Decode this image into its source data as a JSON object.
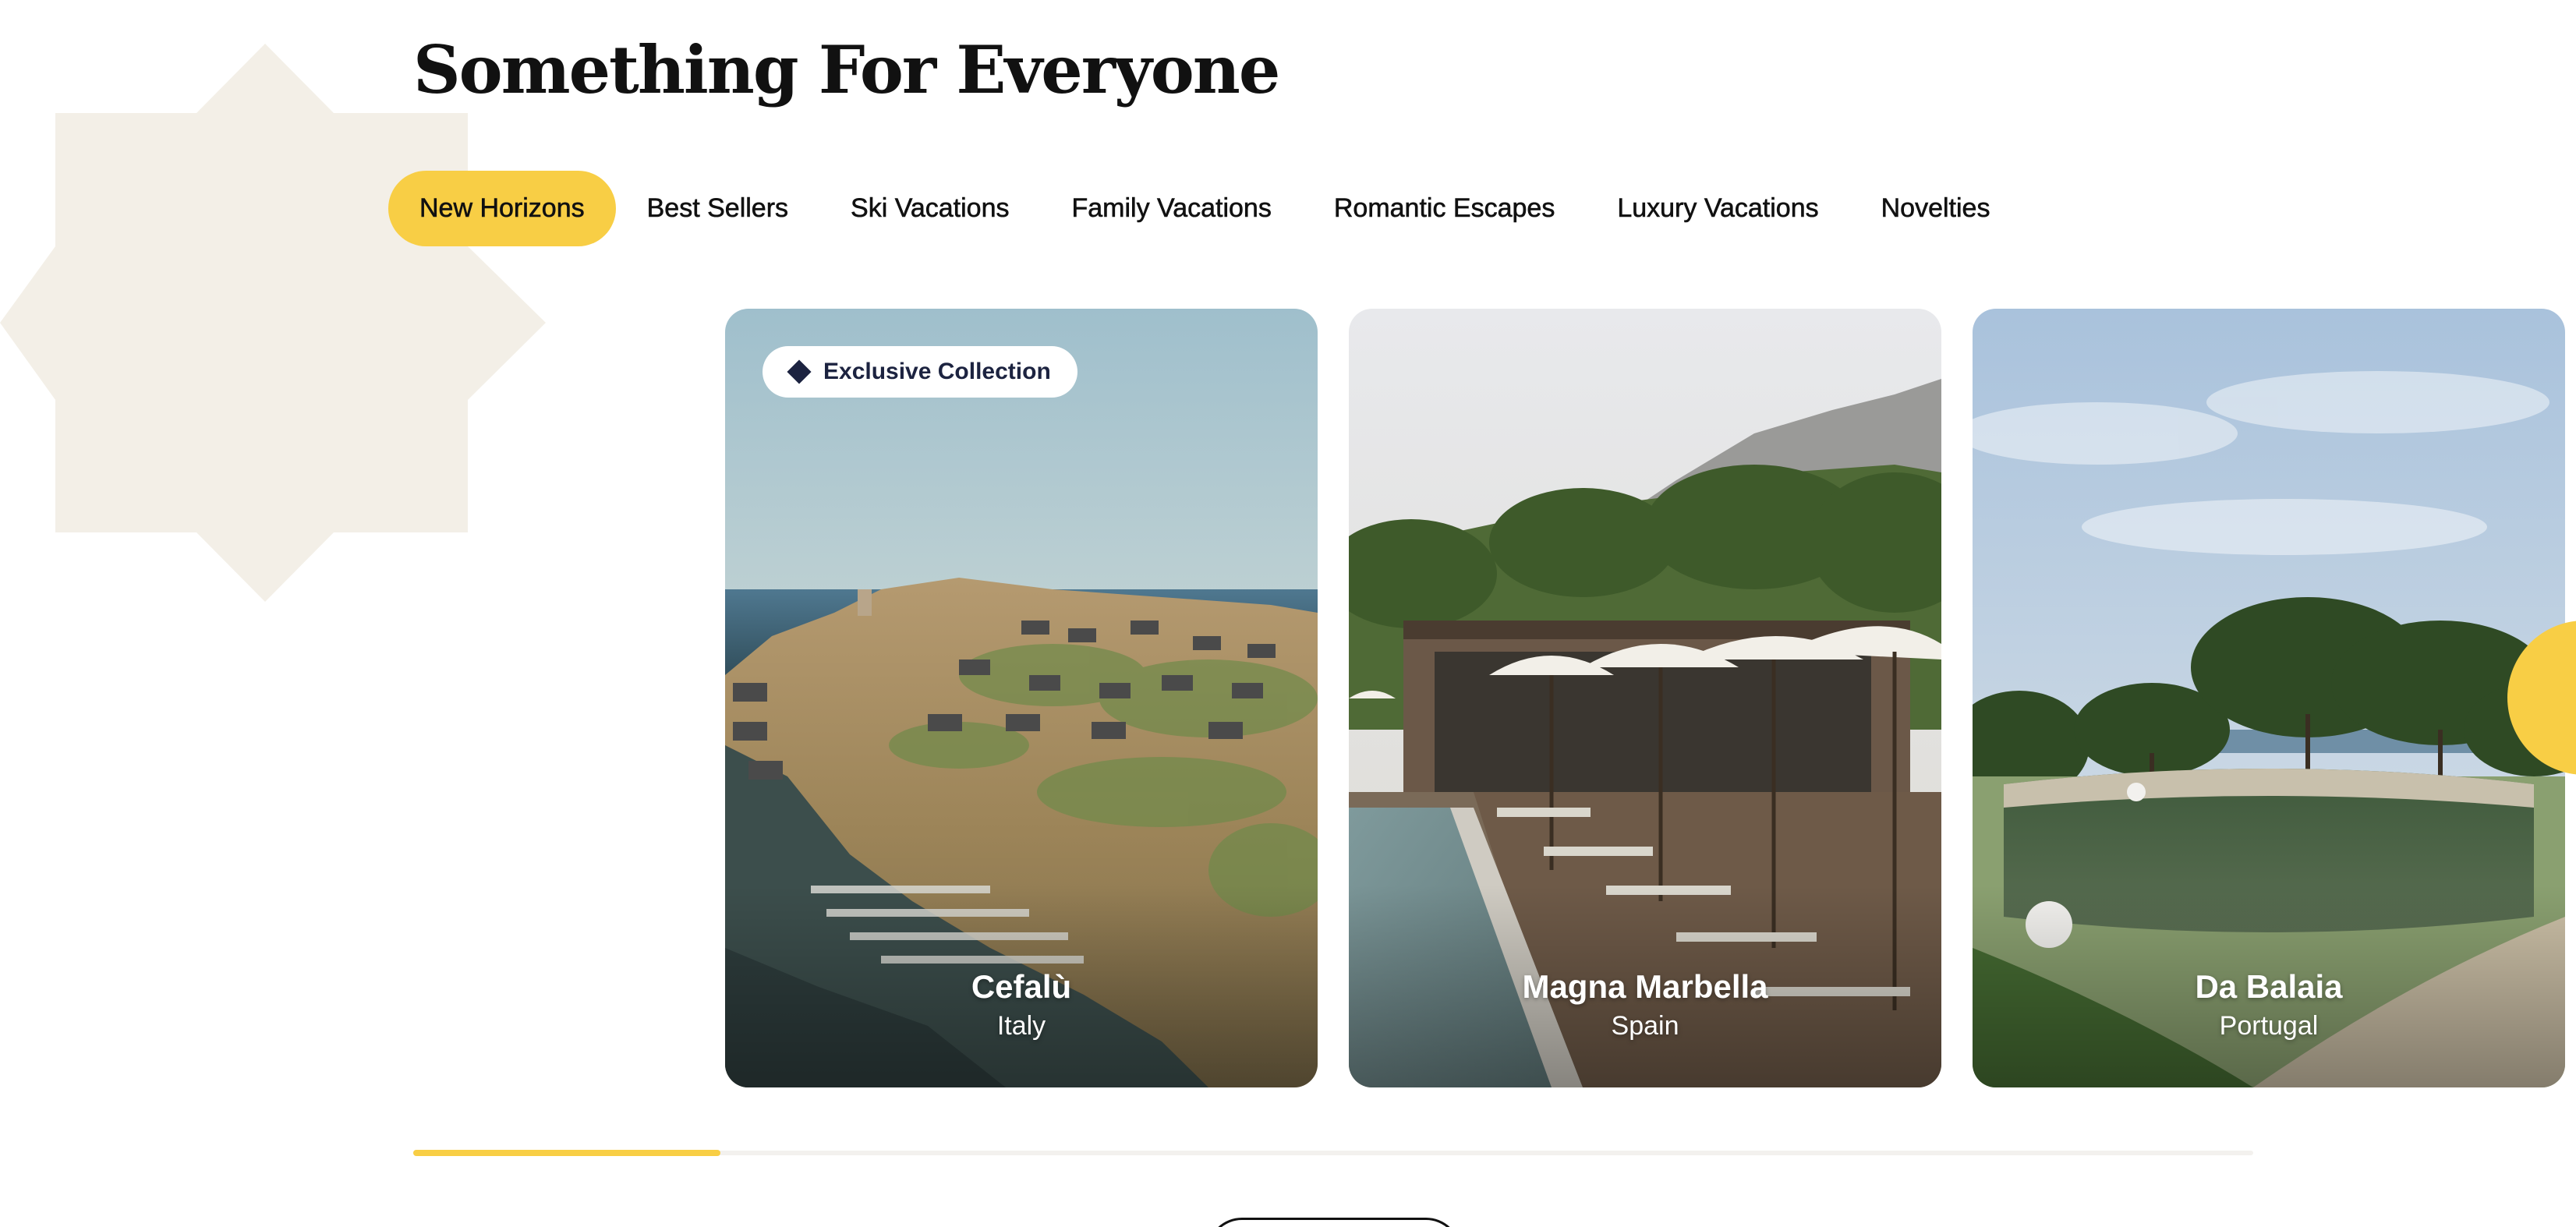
{
  "section": {
    "title": "Something For Everyone"
  },
  "tabs": [
    {
      "label": "New Horizons",
      "active": true
    },
    {
      "label": "Best Sellers",
      "active": false
    },
    {
      "label": "Ski Vacations",
      "active": false
    },
    {
      "label": "Family Vacations",
      "active": false
    },
    {
      "label": "Romantic Escapes",
      "active": false
    },
    {
      "label": "Luxury Vacations",
      "active": false
    },
    {
      "label": "Novelties",
      "active": false
    }
  ],
  "cards": [
    {
      "name": "Cefalù",
      "country": "Italy",
      "badge": "Exclusive Collection",
      "badge_icon": "diamond-icon"
    },
    {
      "name": "Magna Marbella",
      "country": "Spain"
    },
    {
      "name": "Da Balaia",
      "country": "Portugal"
    }
  ],
  "carousel": {
    "progress_fraction": 0.167
  },
  "colors": {
    "accent": "#f8ce45",
    "decor_beige": "#f3efe7",
    "badge_dark": "#1c2340",
    "text": "#111111"
  }
}
